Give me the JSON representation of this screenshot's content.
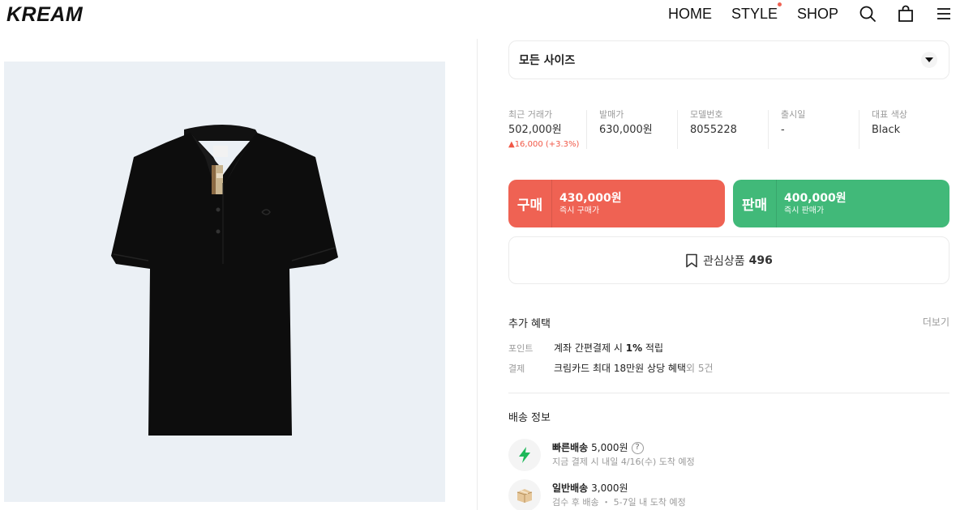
{
  "header": {
    "logo": "KREAM",
    "nav": [
      "HOME",
      "STYLE",
      "SHOP"
    ],
    "icons": [
      "search-icon",
      "shopping-bag-icon",
      "menu-icon"
    ]
  },
  "product_image": {
    "icon": "black-polo-shirt-image"
  },
  "size_select": {
    "label": "모든 사이즈",
    "icon": "caret-down-icon"
  },
  "info": {
    "recent_price": {
      "label": "최근 거래가",
      "value": "502,000원",
      "change": "▲16,000 (+3.3%)"
    },
    "release_price": {
      "label": "발매가",
      "value": "630,000원"
    },
    "model_number": {
      "label": "모델번호",
      "value": "8055228"
    },
    "release_date": {
      "label": "출시일",
      "value": "-"
    },
    "color": {
      "label": "대표 색상",
      "value": "Black"
    }
  },
  "buy_button": {
    "title": "구매",
    "price": "430,000원",
    "sub": "즉시 구매가",
    "color": "#ef6253"
  },
  "sell_button": {
    "title": "판매",
    "price": "400,000원",
    "sub": "즉시 판매가",
    "color": "#41b979"
  },
  "wish": {
    "label": "관심상품",
    "count": "496",
    "icon": "bookmark-icon"
  },
  "benefits": {
    "title": "추가 혜택",
    "more": "더보기",
    "items": [
      {
        "key": "포인트",
        "pre": "계좌 간편결제 시 ",
        "bold": "1%",
        "post": " 적립",
        "extra": ""
      },
      {
        "key": "결제",
        "pre": "크림카드 최대 18만원 상당 혜택",
        "bold": "",
        "post": "",
        "extra": " 외 5건"
      }
    ]
  },
  "shipping": {
    "title": "배송 정보",
    "items": [
      {
        "icon": "lightning-icon",
        "name": "빠른배송",
        "price": "5,000원",
        "help": "?",
        "desc": "지금 결제 시 내일 4/16(수) 도착 예정"
      },
      {
        "icon": "box-icon",
        "name": "일반배송",
        "price": "3,000원",
        "desc": "검수 후 배송 ・ 5-7일 내 도착 예정"
      }
    ]
  }
}
